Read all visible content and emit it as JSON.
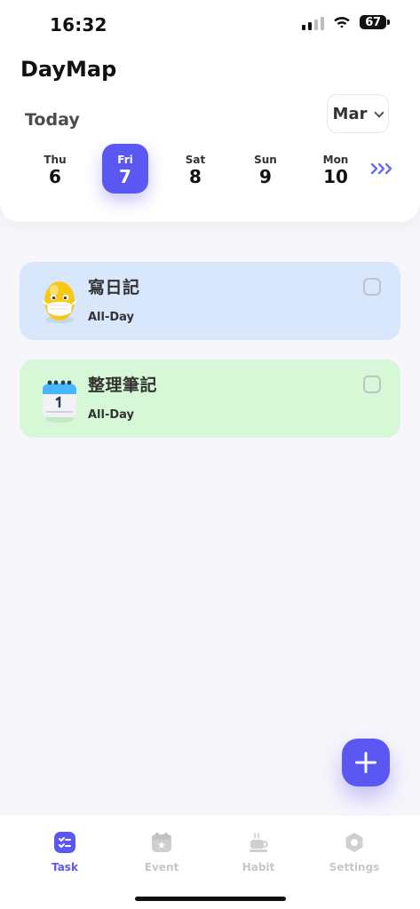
{
  "status_bar": {
    "time": "16:32",
    "battery": "67"
  },
  "header": {
    "app_title": "DayMap",
    "today_label": "Today",
    "month": "Mar"
  },
  "days": [
    {
      "dow": "Thu",
      "num": "6",
      "selected": false
    },
    {
      "dow": "Fri",
      "num": "7",
      "selected": true
    },
    {
      "dow": "Sat",
      "num": "8",
      "selected": false
    },
    {
      "dow": "Sun",
      "num": "9",
      "selected": false
    },
    {
      "dow": "Mon",
      "num": "10",
      "selected": false
    }
  ],
  "next_days_icon": "triple-chevron-right-icon",
  "tasks": [
    {
      "title": "寫日記",
      "subtitle": "All-Day",
      "icon": "egg-mask-icon",
      "color": "#d8e7fb"
    },
    {
      "title": "整理筆記",
      "subtitle": "All-Day",
      "icon": "calendar-june-icon",
      "color": "#d7f8d7"
    }
  ],
  "fab_icon": "plus-icon",
  "tabs": [
    {
      "label": "Task",
      "icon": "task-list-icon",
      "active": true
    },
    {
      "label": "Event",
      "icon": "calendar-star-icon",
      "active": false
    },
    {
      "label": "Habit",
      "icon": "coffee-cup-icon",
      "active": false
    },
    {
      "label": "Settings",
      "icon": "settings-hex-icon",
      "active": false
    }
  ],
  "colors": {
    "accent": "#5b57f2",
    "background": "#f7f6fb",
    "card_blue": "#d8e7fb",
    "card_green": "#d7f8d7"
  }
}
